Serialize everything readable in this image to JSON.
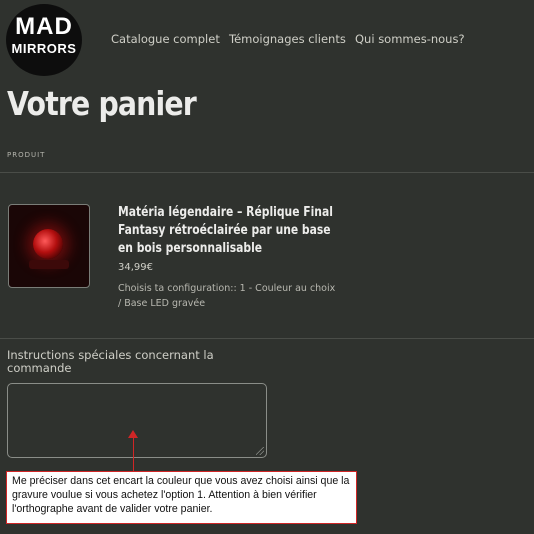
{
  "brand": {
    "logo_line1": "MAD",
    "logo_line2": "MIRRORS"
  },
  "nav": {
    "items": [
      "Catalogue complet",
      "Témoignages clients",
      "Qui sommes-nous?"
    ]
  },
  "cart": {
    "title": "Votre panier",
    "column_header": "PRODUIT",
    "item": {
      "title": "Matéria légendaire – Réplique Final Fantasy rétroéclairée par une base en bois personnalisable",
      "price": "34,99€",
      "config": "Choisis ta configuration:: 1 - Couleur au choix / Base LED gravée"
    },
    "instructions_label": "Instructions spéciales concernant la commande",
    "instructions_value": ""
  },
  "annotation": {
    "text": "Me préciser dans cet encart la couleur que vous avez choisi ainsi que la gravure voulue si vous achetez l'option 1. Attention à bien vérifier l'orthographe avant de valider votre panier.",
    "color": "#d02626"
  },
  "colors": {
    "background": "#2f322e",
    "text": "#e6e6e0",
    "accent": "#c21f1f"
  }
}
